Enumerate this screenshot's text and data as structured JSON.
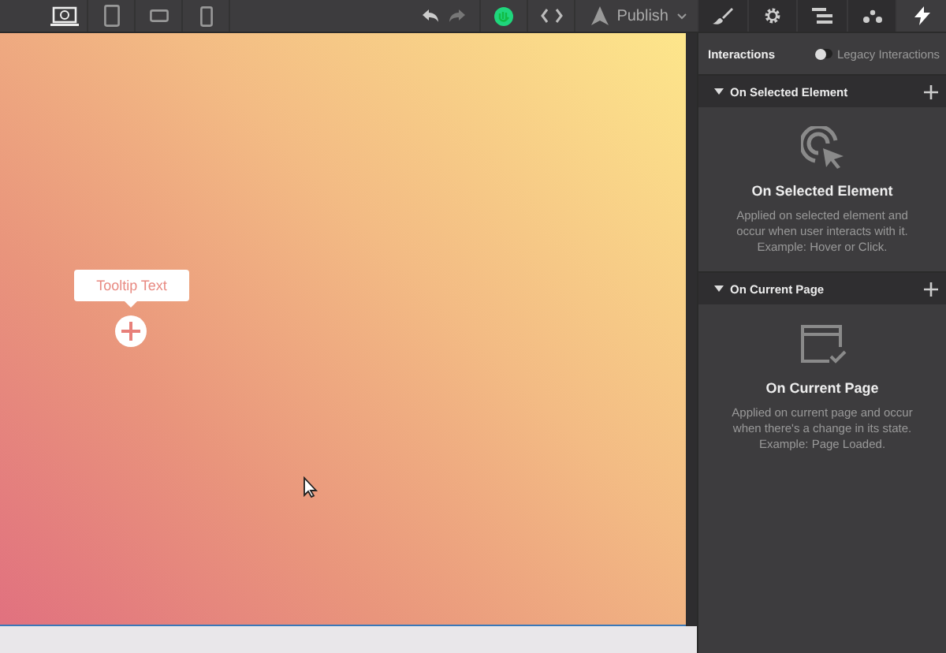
{
  "devices": [
    {
      "kind": "desktop",
      "selected": true
    },
    {
      "kind": "tablet",
      "selected": false
    },
    {
      "kind": "landscape",
      "selected": false
    },
    {
      "kind": "phone",
      "selected": false
    }
  ],
  "publish": {
    "label": "Publish"
  },
  "panel_tabs": [
    {
      "kind": "brush",
      "selected": false
    },
    {
      "kind": "gear",
      "selected": false
    },
    {
      "kind": "navigator",
      "selected": false
    },
    {
      "kind": "drops",
      "selected": false
    },
    {
      "kind": "bolt",
      "selected": true
    }
  ],
  "interactions": {
    "title": "Interactions",
    "legacy": {
      "label": "Legacy Interactions",
      "on": false
    }
  },
  "sections": [
    {
      "kind": "element",
      "title": "On Selected Element",
      "heading": "On Selected Element",
      "description": "Applied on selected element and occur when user interacts with it. Example: Hover or Click.",
      "expanded": true
    },
    {
      "kind": "page",
      "title": "On Current Page",
      "heading": "On Current Page",
      "description": "Applied on current page and occur when there's a change in its state. Example: Page Loaded.",
      "expanded": true
    }
  ],
  "canvas": {
    "tooltip": "Tooltip Text"
  }
}
